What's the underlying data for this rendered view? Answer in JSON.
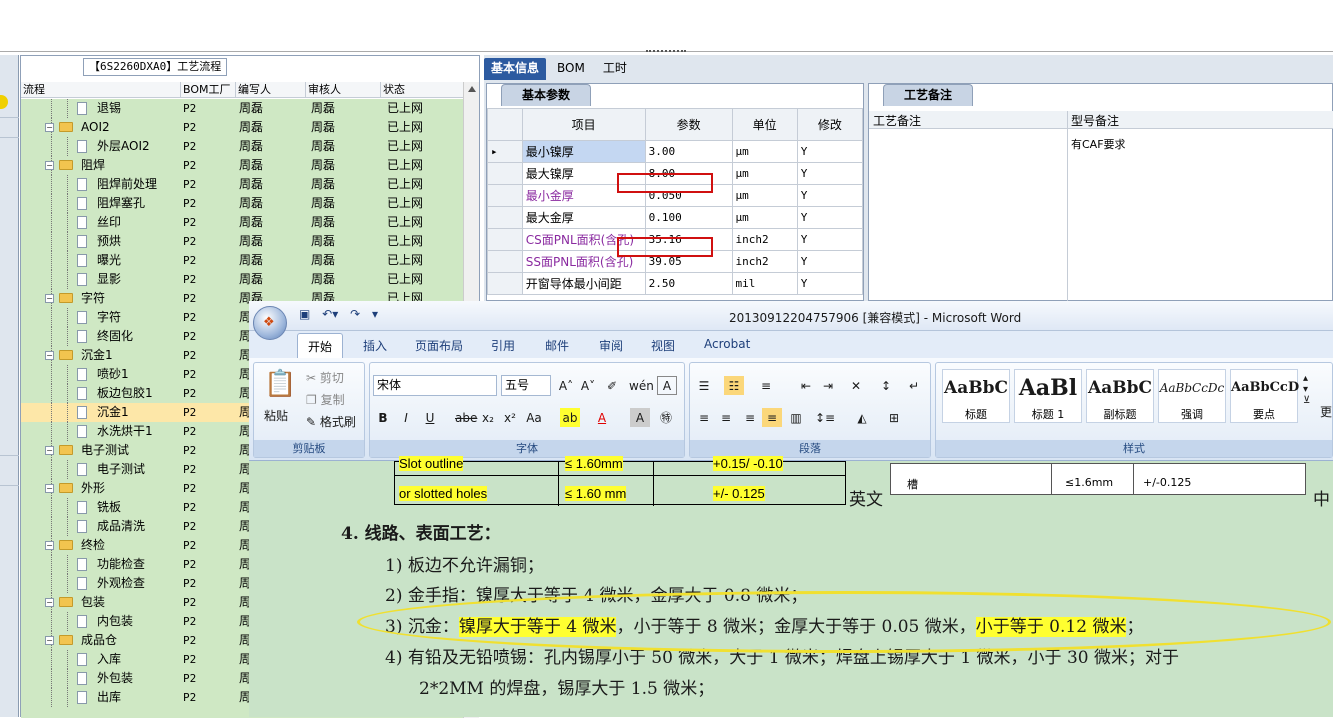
{
  "tree_panel": {
    "caption": "【6S2260DXA0】工艺流程",
    "columns": [
      "流程",
      "BOM工厂",
      "编写人",
      "审核人",
      "状态"
    ],
    "rows": [
      {
        "name": "退锡",
        "level": 2,
        "bom": "P2",
        "writer": "周磊",
        "reviewer": "周磊",
        "status": "已上网"
      },
      {
        "name": "AOI2",
        "level": 1,
        "bom": "P2",
        "writer": "周磊",
        "reviewer": "周磊",
        "status": "已上网"
      },
      {
        "name": "外层AOI2",
        "level": 2,
        "bom": "P2",
        "writer": "周磊",
        "reviewer": "周磊",
        "status": "已上网"
      },
      {
        "name": "阻焊",
        "level": 1,
        "bom": "P2",
        "writer": "周磊",
        "reviewer": "周磊",
        "status": "已上网"
      },
      {
        "name": "阻焊前处理",
        "level": 2,
        "bom": "P2",
        "writer": "周磊",
        "reviewer": "周磊",
        "status": "已上网"
      },
      {
        "name": "阻焊塞孔",
        "level": 2,
        "bom": "P2",
        "writer": "周磊",
        "reviewer": "周磊",
        "status": "已上网"
      },
      {
        "name": "丝印",
        "level": 2,
        "bom": "P2",
        "writer": "周磊",
        "reviewer": "周磊",
        "status": "已上网"
      },
      {
        "name": "预烘",
        "level": 2,
        "bom": "P2",
        "writer": "周磊",
        "reviewer": "周磊",
        "status": "已上网"
      },
      {
        "name": "曝光",
        "level": 2,
        "bom": "P2",
        "writer": "周磊",
        "reviewer": "周磊",
        "status": "已上网"
      },
      {
        "name": "显影",
        "level": 2,
        "bom": "P2",
        "writer": "周磊",
        "reviewer": "周磊",
        "status": "已上网"
      },
      {
        "name": "字符",
        "level": 1,
        "bom": "P2",
        "writer": "周磊",
        "reviewer": "周磊",
        "status": "已上网"
      },
      {
        "name": "字符",
        "level": 2,
        "bom": "P2",
        "writer": "周",
        "reviewer": "",
        "status": ""
      },
      {
        "name": "终固化",
        "level": 2,
        "bom": "P2",
        "writer": "周",
        "reviewer": "",
        "status": ""
      },
      {
        "name": "沉金1",
        "level": 1,
        "bom": "P2",
        "writer": "周",
        "reviewer": "",
        "status": ""
      },
      {
        "name": "喷砂1",
        "level": 2,
        "bom": "P2",
        "writer": "周",
        "reviewer": "",
        "status": ""
      },
      {
        "name": "板边包胶1",
        "level": 2,
        "bom": "P2",
        "writer": "周",
        "reviewer": "",
        "status": ""
      },
      {
        "name": "沉金1",
        "level": 2,
        "bom": "P2",
        "writer": "周",
        "reviewer": "",
        "status": "",
        "selected": true
      },
      {
        "name": "水洗烘干1",
        "level": 2,
        "bom": "P2",
        "writer": "周",
        "reviewer": "",
        "status": ""
      },
      {
        "name": "电子测试",
        "level": 1,
        "bom": "P2",
        "writer": "周",
        "reviewer": "",
        "status": ""
      },
      {
        "name": "电子测试",
        "level": 2,
        "bom": "P2",
        "writer": "周",
        "reviewer": "",
        "status": ""
      },
      {
        "name": "外形",
        "level": 1,
        "bom": "P2",
        "writer": "周",
        "reviewer": "",
        "status": ""
      },
      {
        "name": "铣板",
        "level": 2,
        "bom": "P2",
        "writer": "周",
        "reviewer": "",
        "status": ""
      },
      {
        "name": "成品清洗",
        "level": 2,
        "bom": "P2",
        "writer": "周",
        "reviewer": "",
        "status": ""
      },
      {
        "name": "终检",
        "level": 1,
        "bom": "P2",
        "writer": "周",
        "reviewer": "",
        "status": ""
      },
      {
        "name": "功能检查",
        "level": 2,
        "bom": "P2",
        "writer": "周",
        "reviewer": "",
        "status": ""
      },
      {
        "name": "外观检查",
        "level": 2,
        "bom": "P2",
        "writer": "周",
        "reviewer": "",
        "status": ""
      },
      {
        "name": "包装",
        "level": 1,
        "bom": "P2",
        "writer": "周",
        "reviewer": "",
        "status": ""
      },
      {
        "name": "内包装",
        "level": 2,
        "bom": "P2",
        "writer": "周",
        "reviewer": "",
        "status": ""
      },
      {
        "name": "成品仓",
        "level": 1,
        "bom": "P2",
        "writer": "周",
        "reviewer": "",
        "status": ""
      },
      {
        "name": "入库",
        "level": 2,
        "bom": "P2",
        "writer": "周",
        "reviewer": "",
        "status": ""
      },
      {
        "name": "外包装",
        "level": 2,
        "bom": "P2",
        "writer": "周",
        "reviewer": "",
        "status": ""
      },
      {
        "name": "出库",
        "level": 2,
        "bom": "P2",
        "writer": "周",
        "reviewer": "",
        "status": ""
      }
    ]
  },
  "right_tabs": [
    "基本信息",
    "BOM",
    "工时"
  ],
  "basic_panel": {
    "subtab": "基本参数",
    "columns": [
      "项目",
      "参数",
      "单位",
      "修改"
    ],
    "rows": [
      {
        "item": "最小镍厚",
        "value": "3.00",
        "unit": "μm",
        "mod": "Y",
        "current": true
      },
      {
        "item": "最大镍厚",
        "value": "8.00",
        "unit": "μm",
        "mod": "Y"
      },
      {
        "item": "最小金厚",
        "value": "0.050",
        "unit": "μm",
        "mod": "Y",
        "purple": true
      },
      {
        "item": "最大金厚",
        "value": "0.100",
        "unit": "μm",
        "mod": "Y"
      },
      {
        "item": "CS面PNL面积(含孔)",
        "value": "35.16",
        "unit": "inch2",
        "mod": "Y",
        "purple": true
      },
      {
        "item": "SS面PNL面积(含孔)",
        "value": "39.05",
        "unit": "inch2",
        "mod": "Y",
        "purple": true
      },
      {
        "item": "开窗导体最小间距",
        "value": "2.50",
        "unit": "mil",
        "mod": "Y"
      }
    ]
  },
  "notes_panel": {
    "tab": "工艺备注",
    "col1": "工艺备注",
    "col2": "型号备注",
    "note_value": "有CAF要求"
  },
  "word": {
    "title": "20130912204757906 [兼容模式] - Microsoft Word",
    "menu": [
      "开始",
      "插入",
      "页面布局",
      "引用",
      "邮件",
      "审阅",
      "视图",
      "Acrobat"
    ],
    "clipboard": {
      "paste": "粘贴",
      "cut": "剪切",
      "copy": "复制",
      "format": "格式刷",
      "label": "剪贴板"
    },
    "font": {
      "name": "宋体",
      "size": "五号",
      "label": "字体"
    },
    "paragraph_label": "段落",
    "styles": {
      "items": [
        {
          "preview": "AaBbC",
          "name": "标题"
        },
        {
          "preview": "AaBl",
          "name": "标题 1"
        },
        {
          "preview": "AaBbC",
          "name": "副标题"
        },
        {
          "preview": "AaBbCcDc",
          "name": "强调"
        },
        {
          "preview": "AaBbCcD",
          "name": "要点"
        }
      ],
      "label": "样式",
      "more": "更"
    },
    "doc": {
      "table_row1": [
        "Slot outline",
        "≤ 1.60mm",
        "+0.15/ -0.10"
      ],
      "table_row2": [
        "or slotted holes",
        "≤ 1.60 mm",
        "+/- 0.125"
      ],
      "english_label": "英文",
      "cn_cells": [
        "槽",
        "≤1.6mm",
        "+/-0.125"
      ],
      "cn_tail": "中",
      "heading": "4.   线路、表面工艺：",
      "line1": "1)  板边不允许漏铜；",
      "line2": "2)  金手指：镍厚大于等于 4 微米，金厚大于 0.8 微米；",
      "line3_prefix": "3)  沉金：",
      "line3_hl1": "镍厚大于等于 4 微米",
      "line3_mid": "，小于等于 8 微米；金厚大于等于 0.05 微米，",
      "line3_hl2": "小于等于 0.12 微米",
      "line3_end": "；",
      "line4": "4)  有铅及无铅喷锡：孔内锡厚小于 50 微米，大于 1 微米；焊盘上锡厚大于 1 微米，小于 30 微米；对于",
      "line5": "2*2MM 的焊盘，锡厚大于 1.5 微米；"
    }
  }
}
